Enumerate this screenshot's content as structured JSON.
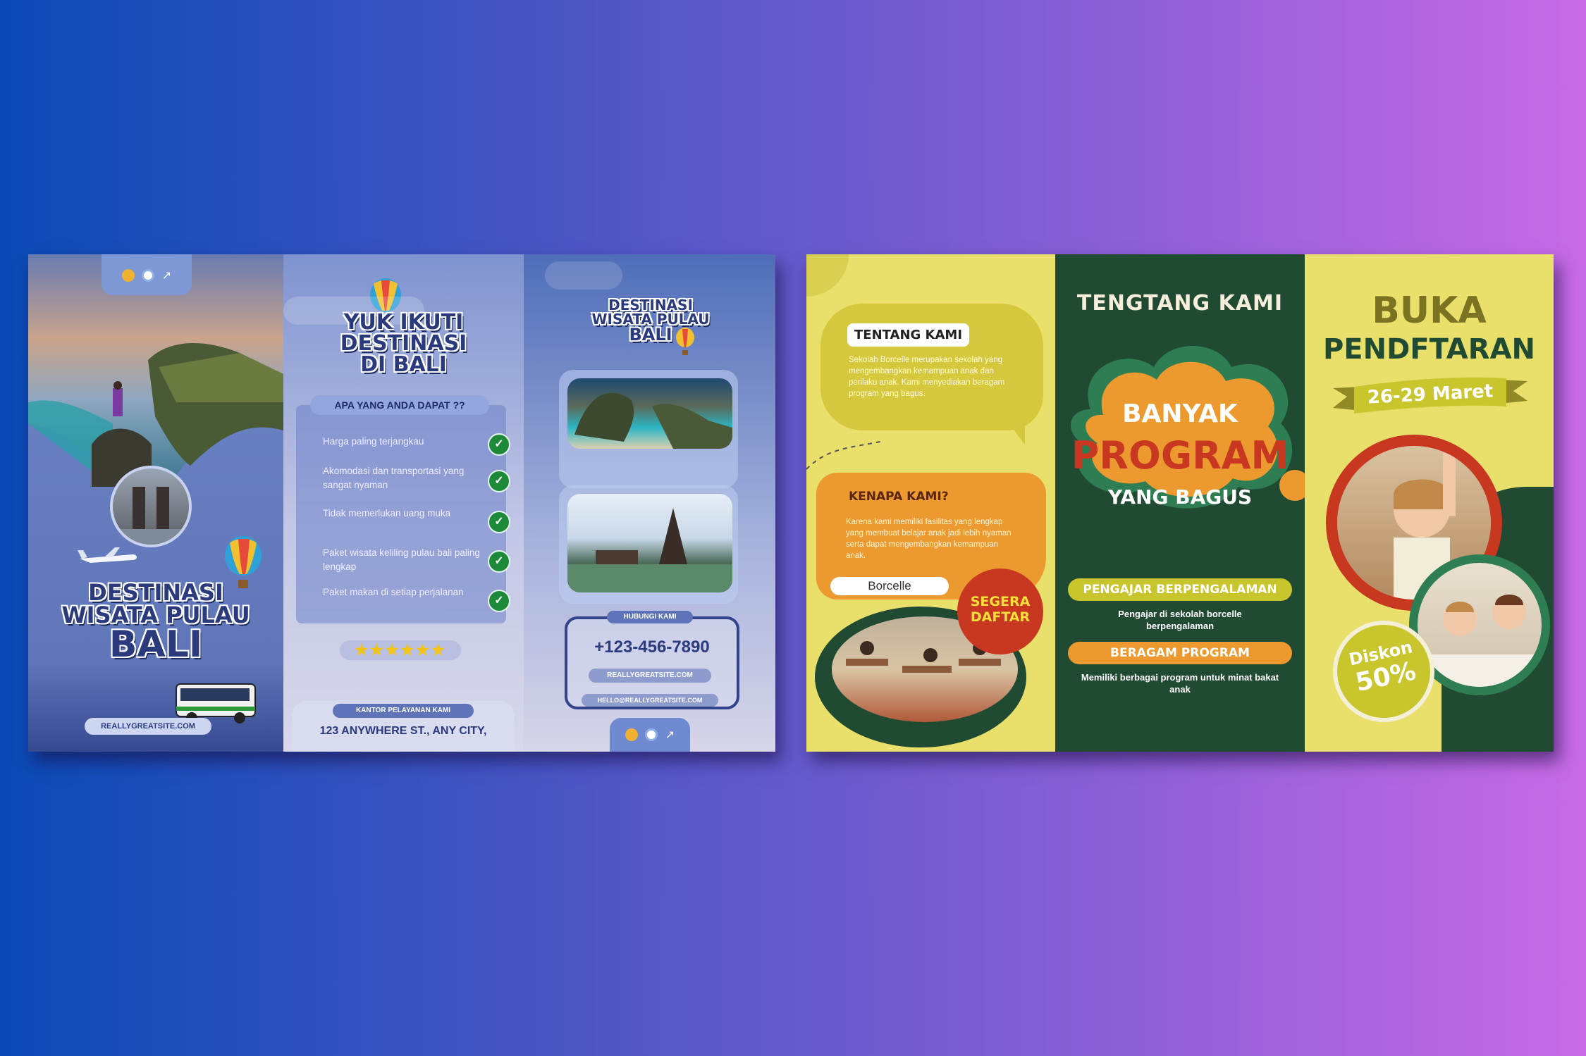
{
  "bali": {
    "logo_icons": [
      "swirl-icon",
      "circle-icon",
      "runner-icon"
    ],
    "panel1": {
      "title_line1": "DESTINASI",
      "title_line2": "WISATA PULAU",
      "title_line3": "BALI",
      "website": "REALLYGREATSITE.COM"
    },
    "panel2": {
      "title_line1": "YUK IKUTI",
      "title_line2": "DESTINASI",
      "title_line3": "DI BALI",
      "benefits_heading": "APA YANG ANDA DAPAT ??",
      "benefits": [
        "Harga paling terjangkau",
        "Akomodasi dan transportasi yang sangat nyaman",
        "Tidak memerlukan uang muka",
        "Paket wisata keliling pulau bali paling lengkap",
        "Paket makan di setiap perjalanan"
      ],
      "stars": "★★★★★★",
      "office_label": "KANTOR PELAYANAN KAMI",
      "address": "123 ANYWHERE ST., ANY CITY,"
    },
    "panel3": {
      "title_line1": "DESTINASI",
      "title_line2": "WISATA PULAU",
      "title_line3": "BALI",
      "contact_label": "HUBUNGI KAMI",
      "phone": "+123-456-7890",
      "website": "REALLYGREATSITE.COM",
      "email": "HELLO@REALLYGREATSITE.COM"
    }
  },
  "school": {
    "panel1": {
      "about_heading": "TENTANG KAMI",
      "about_text": "Sekolah Borcelle merupakan sekolah yang mengembangkan kemampuan anak dan perilaku anak. Kami menyediakan beragam program yang bagus.",
      "why_heading": "KENAPA KAMI?",
      "why_text": "Karena kami memiliki fasilitas yang lengkap yang membuat belajar anak jadi lebih nyaman serta dapat mengembangkan kemampuan anak.",
      "name_tag": "Borcelle",
      "cta_line1": "SEGERA",
      "cta_line2": "DAFTAR"
    },
    "panel2": {
      "arc_title": "TENGTANG KAMI",
      "cloud_line1": "BANYAK",
      "cloud_line2": "PROGRAM",
      "cloud_line3": "YANG BAGUS",
      "feature1_label": "PENGAJAR BERPENGALAMAN",
      "feature1_text": "Pengajar di sekolah borcelle berpengalaman",
      "feature2_label": "BERAGAM PROGRAM",
      "feature2_text": "Memiliki berbagai program untuk minat bakat anak"
    },
    "panel3": {
      "title_line1": "BUKA",
      "title_line2": "PENDFTARAN",
      "date_ribbon": "26-29 Maret",
      "discount_line1": "Diskon",
      "discount_line2": "50%"
    }
  },
  "colors": {
    "bali_navy": "#2a3a7c",
    "school_yellow": "#e9df6b",
    "school_green": "#204b32",
    "school_orange": "#ec9a2f",
    "school_red": "#c8371f",
    "school_lime": "#c9c62d"
  }
}
